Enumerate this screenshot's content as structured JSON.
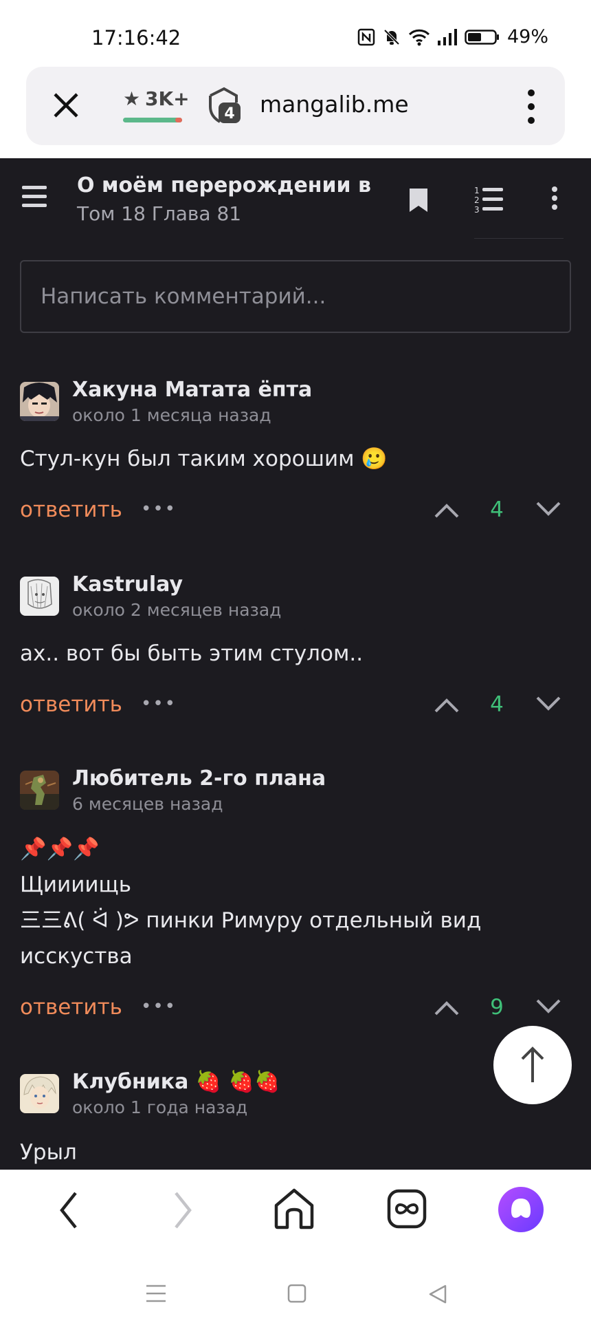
{
  "status_bar": {
    "time": "17:16:42",
    "battery_percent": "49%",
    "icons": [
      "nfc-icon",
      "mute-bell-icon",
      "wifi-icon",
      "signal-icon",
      "battery-icon"
    ]
  },
  "browser": {
    "rating": "3K+",
    "tabs_count": "4",
    "url": "mangalib.me"
  },
  "header": {
    "title": "О моём перерождении в ...",
    "subtitle": "Том 18 Глава 81"
  },
  "comment_input": {
    "placeholder": "Написать комментарий..."
  },
  "comments": [
    {
      "author": "Хакуна Матата ёпта",
      "time": "около 1 месяца назад",
      "text": "Стул-кун был таким хорошим 🥲",
      "reply_label": "ответить",
      "more": "•••",
      "votes": "4"
    },
    {
      "author": "Kastrulay",
      "time": "около 2 месяцев назад",
      "text": "ах.. вот бы быть этим стулом..",
      "reply_label": "ответить",
      "more": "•••",
      "votes": "4"
    },
    {
      "author": "Любитель 2-го плана",
      "time": "6 месяцев назад",
      "text_lines": [
        "📌📌📌",
        "Щиииищь",
        "三三ᕕ( ᐛ )ᕗ пинки Римуру отдельный вид",
        "исскуства"
      ],
      "reply_label": "ответить",
      "more": "•••",
      "votes": "9"
    },
    {
      "author": "Клубника 🍓 🍓🍓",
      "time": "около 1 года назад",
      "text": "Урыл"
    }
  ],
  "colors": {
    "background": "#1c1b20",
    "reply": "#f08b5a",
    "vote_positive": "#3fbf78",
    "text": "#e8e8ec",
    "muted": "#8f8f97"
  }
}
